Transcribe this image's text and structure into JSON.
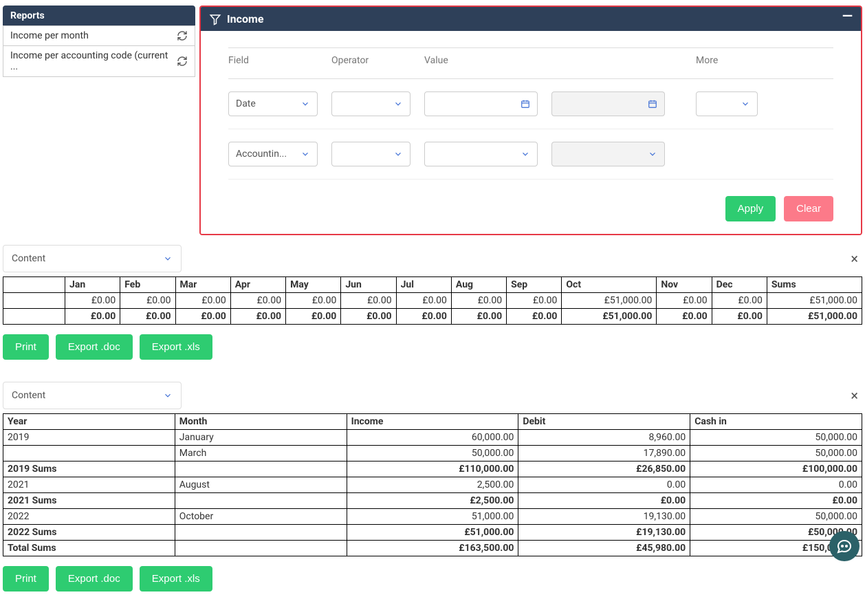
{
  "sidebar": {
    "title": "Reports",
    "items": [
      {
        "label": "Income per month"
      },
      {
        "label": "Income per accounting code (current ..."
      }
    ]
  },
  "filter": {
    "title": "Income",
    "columns": {
      "field": "Field",
      "operator": "Operator",
      "value": "Value",
      "more": "More"
    },
    "rows": [
      {
        "field": "Date"
      },
      {
        "field": "Accountin..."
      }
    ],
    "apply": "Apply",
    "clear": "Clear"
  },
  "content_label": "Content",
  "table1": {
    "headers": [
      "",
      "Jan",
      "Feb",
      "Mar",
      "Apr",
      "May",
      "Jun",
      "Jul",
      "Aug",
      "Sep",
      "Oct",
      "Nov",
      "Dec",
      "Sums"
    ],
    "row": [
      "",
      "£0.00",
      "£0.00",
      "£0.00",
      "£0.00",
      "£0.00",
      "£0.00",
      "£0.00",
      "£0.00",
      "£0.00",
      "£51,000.00",
      "£0.00",
      "£0.00",
      "£51,000.00"
    ],
    "totals": [
      "",
      "£0.00",
      "£0.00",
      "£0.00",
      "£0.00",
      "£0.00",
      "£0.00",
      "£0.00",
      "£0.00",
      "£0.00",
      "£51,000.00",
      "£0.00",
      "£0.00",
      "£51,000.00"
    ]
  },
  "actions": {
    "print": "Print",
    "doc": "Export .doc",
    "xls": "Export .xls"
  },
  "table2": {
    "headers": [
      "Year",
      "Month",
      "Income",
      "Debit",
      "Cash in"
    ],
    "rows": [
      {
        "year": "2019",
        "month": "January",
        "income": "60,000.00",
        "debit": "8,960.00",
        "cash": "50,000.00",
        "bold": false
      },
      {
        "year": "",
        "month": "March",
        "income": "50,000.00",
        "debit": "17,890.00",
        "cash": "50,000.00",
        "bold": false
      },
      {
        "year": "2019 Sums",
        "month": "",
        "income": "£110,000.00",
        "debit": "£26,850.00",
        "cash": "£100,000.00",
        "bold": true
      },
      {
        "year": "2021",
        "month": "August",
        "income": "2,500.00",
        "debit": "0.00",
        "cash": "0.00",
        "bold": false
      },
      {
        "year": "2021 Sums",
        "month": "",
        "income": "£2,500.00",
        "debit": "£0.00",
        "cash": "£0.00",
        "bold": true
      },
      {
        "year": "2022",
        "month": "October",
        "income": "51,000.00",
        "debit": "19,130.00",
        "cash": "50,000.00",
        "bold": false
      },
      {
        "year": "2022 Sums",
        "month": "",
        "income": "£51,000.00",
        "debit": "£19,130.00",
        "cash": "£50,000.00",
        "bold": true
      },
      {
        "year": "Total Sums",
        "month": "",
        "income": "£163,500.00",
        "debit": "£45,980.00",
        "cash": "£150,000.00",
        "bold": true
      }
    ]
  }
}
